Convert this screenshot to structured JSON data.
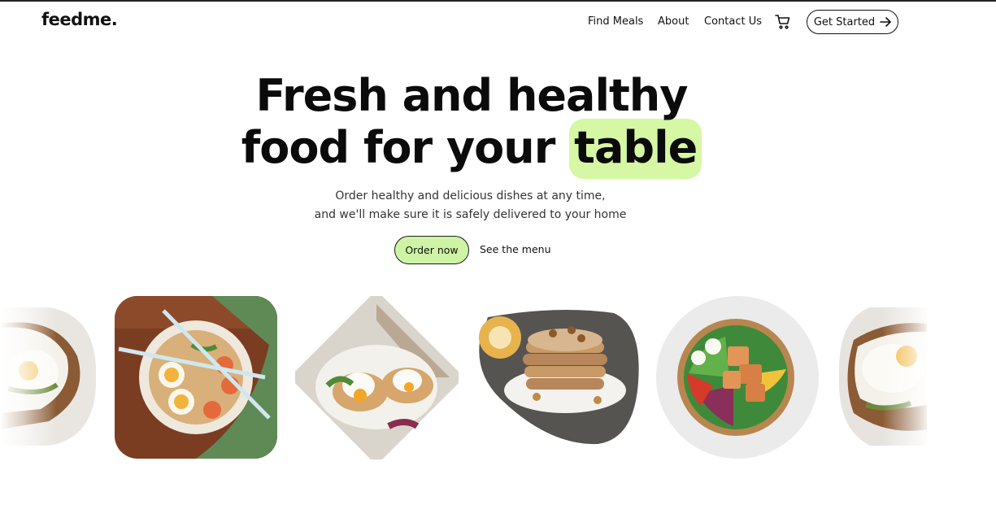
{
  "brand": {
    "logo": "feedme."
  },
  "nav": {
    "links": [
      "Find Meals",
      "About",
      "Contact Us"
    ],
    "cart_icon": "cart-icon",
    "cta_label": "Get Started",
    "cta_icon": "arrow-right-icon"
  },
  "hero": {
    "title_line1": "Fresh and healthy",
    "title_line2_prefix": "food for your",
    "title_highlight": "table",
    "subtitle_line1": "Order healthy and delicious dishes at any time,",
    "subtitle_line2": "and we'll make sure it is safely delivered to your home",
    "primary_button": "Order now",
    "secondary_link": "See the menu"
  },
  "colors": {
    "accent": "#cef3a4",
    "highlight": "#d6f7a3",
    "text": "#111111",
    "background": "#ffffff"
  },
  "gallery": {
    "items": [
      {
        "name": "fried-egg-toast"
      },
      {
        "name": "ramen-bowl"
      },
      {
        "name": "poached-egg-avocado-toast"
      },
      {
        "name": "pancake-stack"
      },
      {
        "name": "salmon-poke-bowl"
      },
      {
        "name": "fried-egg-toast"
      }
    ]
  }
}
